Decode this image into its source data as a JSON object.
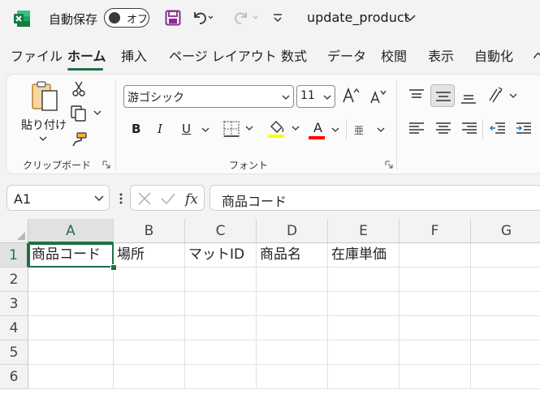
{
  "titlebar": {
    "autosave_label": "自動保存",
    "autosave_state": "オフ",
    "document_title": "update_product"
  },
  "tabs": [
    "ファイル",
    "ホーム",
    "挿入",
    "ページ レイアウト",
    "数式",
    "データ",
    "校閲",
    "表示",
    "自動化"
  ],
  "active_tab": "ホーム",
  "ribbon": {
    "clipboard": {
      "paste_label": "貼り付け",
      "group_label": "クリップボード"
    },
    "font": {
      "font_name": "游ゴシック",
      "font_size": "11",
      "group_label": "フォント",
      "bold": "B",
      "italic": "I",
      "underline": "U",
      "font_color_letter": "A",
      "phonetic": "亜"
    }
  },
  "formula_bar": {
    "name_box": "A1",
    "formula": "商品コード"
  },
  "grid": {
    "columns": [
      "A",
      "B",
      "C",
      "D",
      "E",
      "F",
      "G"
    ],
    "rows": [
      "1",
      "2",
      "3",
      "4",
      "5",
      "6"
    ],
    "row1_values": [
      "商品コード",
      "場所",
      "マットID",
      "商品名",
      "在庫単価",
      "",
      ""
    ]
  },
  "colors": {
    "accent": "#1e7145",
    "highlight": "#ffff00",
    "font_color": "#ff0000",
    "save_icon": "#8a2c8f"
  }
}
